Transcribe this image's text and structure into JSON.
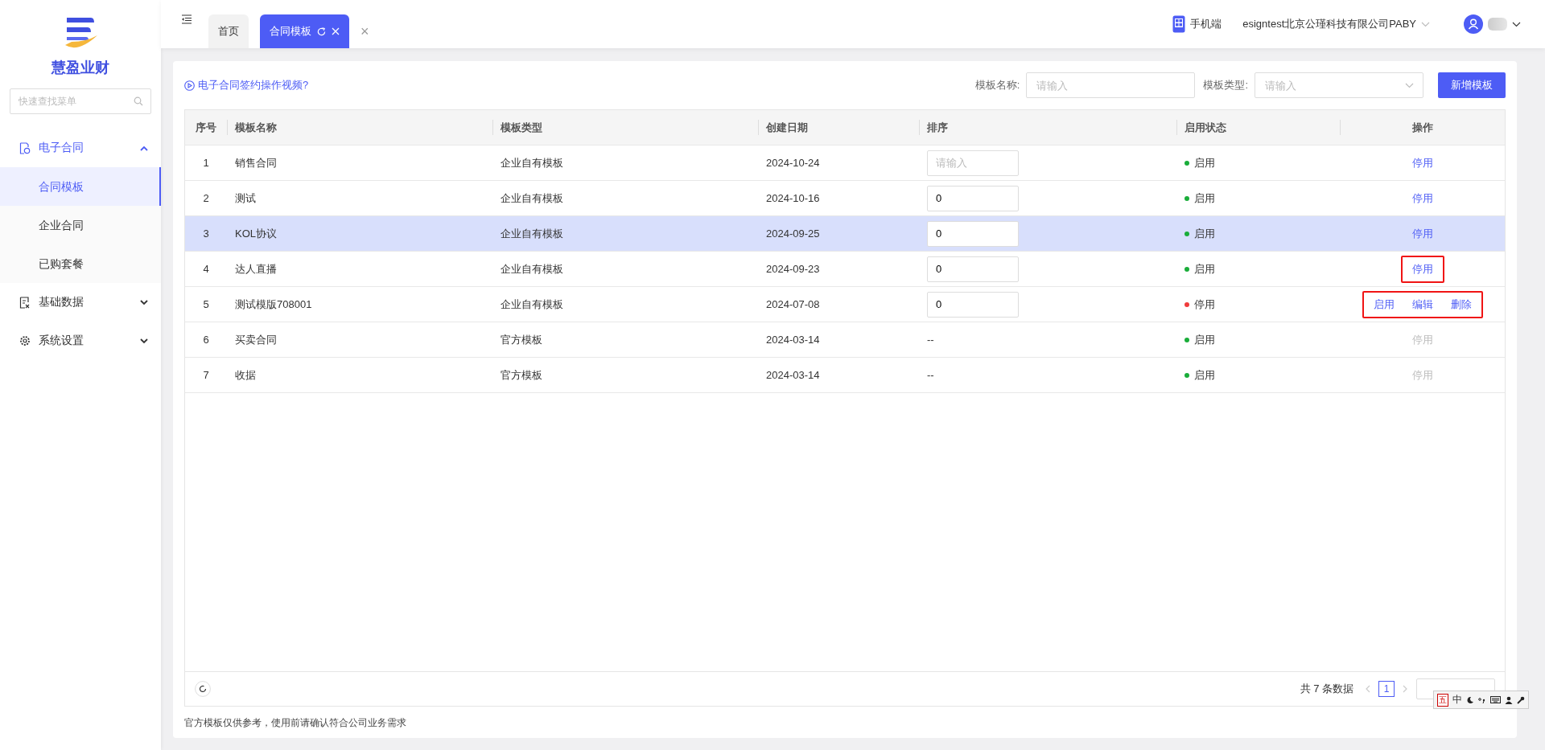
{
  "sidebar": {
    "brand": "慧盈业财",
    "search": {
      "placeholder": "快速查找菜单"
    },
    "items": [
      {
        "label": "电子合同",
        "expanded": true,
        "children": [
          {
            "label": "合同模板",
            "selected": true
          },
          {
            "label": "企业合同",
            "selected": false
          },
          {
            "label": "已购套餐",
            "selected": false
          }
        ]
      },
      {
        "label": "基础数据",
        "expanded": false
      },
      {
        "label": "系统设置",
        "expanded": false
      }
    ]
  },
  "topbar": {
    "tabs": [
      {
        "label": "首页",
        "selected": false
      },
      {
        "label": "合同模板",
        "selected": true
      }
    ],
    "close_all": "×",
    "mobile": "手机端",
    "company": "esigntest北京公瑾科技有限公司PABY"
  },
  "toolbar": {
    "video_link": "电子合同签约操作视频?",
    "filters": [
      {
        "label": "模板名称:",
        "kind": "input",
        "placeholder": "请输入"
      },
      {
        "label": "模板类型:",
        "kind": "select",
        "placeholder": "请输入"
      }
    ],
    "add_button": "新增模板"
  },
  "table": {
    "columns": [
      "序号",
      "模板名称",
      "模板类型",
      "创建日期",
      "排序",
      "启用状态",
      "操作"
    ],
    "rows": [
      {
        "index": "1",
        "name": "销售合同",
        "type": "企业自有模板",
        "date": "2024-10-24",
        "sort": {
          "kind": "input",
          "placeholder": "请输入"
        },
        "status": "启用",
        "color": "#1aad3a",
        "selected": false,
        "annotated": false,
        "actions": [
          {
            "label": "停用",
            "disabled": false
          }
        ]
      },
      {
        "index": "2",
        "name": "测试",
        "type": "企业自有模板",
        "date": "2024-10-16",
        "sort": {
          "kind": "input",
          "value": "0"
        },
        "status": "启用",
        "color": "#1aad3a",
        "selected": false,
        "annotated": false,
        "actions": [
          {
            "label": "停用",
            "disabled": false
          }
        ]
      },
      {
        "index": "3",
        "name": "KOL协议",
        "type": "企业自有模板",
        "date": "2024-09-25",
        "sort": {
          "kind": "input",
          "value": "0"
        },
        "status": "启用",
        "color": "#1aad3a",
        "selected": true,
        "annotated": false,
        "actions": [
          {
            "label": "停用",
            "disabled": false
          }
        ]
      },
      {
        "index": "4",
        "name": "达人直播",
        "type": "企业自有模板",
        "date": "2024-09-23",
        "sort": {
          "kind": "input",
          "value": "0"
        },
        "status": "启用",
        "color": "#1aad3a",
        "selected": false,
        "annotated": true,
        "actions": [
          {
            "label": "停用",
            "disabled": false
          }
        ]
      },
      {
        "index": "5",
        "name": "测试模版708001",
        "type": "企业自有模板",
        "date": "2024-07-08",
        "sort": {
          "kind": "input",
          "value": "0"
        },
        "status": "停用",
        "color": "#f03c3c",
        "selected": false,
        "annotated": true,
        "actions": [
          {
            "label": "启用",
            "disabled": false
          },
          {
            "label": "编辑",
            "disabled": false
          },
          {
            "label": "删除",
            "disabled": false
          }
        ]
      },
      {
        "index": "6",
        "name": "买卖合同",
        "type": "官方模板",
        "date": "2024-03-14",
        "sort": {
          "kind": "text",
          "value": "--"
        },
        "status": "启用",
        "color": "#1aad3a",
        "selected": false,
        "annotated": false,
        "actions": [
          {
            "label": "停用",
            "disabled": true
          }
        ]
      },
      {
        "index": "7",
        "name": "收据",
        "type": "官方模板",
        "date": "2024-03-14",
        "sort": {
          "kind": "text",
          "value": "--"
        },
        "status": "启用",
        "color": "#1aad3a",
        "selected": false,
        "annotated": false,
        "actions": [
          {
            "label": "停用",
            "disabled": true
          }
        ]
      }
    ]
  },
  "pagination": {
    "total": "共 7 条数据",
    "pages": [
      {
        "label": "1",
        "selected": true
      }
    ]
  },
  "ime_toolbar": {
    "mode": "五",
    "language": "中"
  },
  "footnote": "官方模板仅供参考，使用前请确认符合公司业务需求"
}
